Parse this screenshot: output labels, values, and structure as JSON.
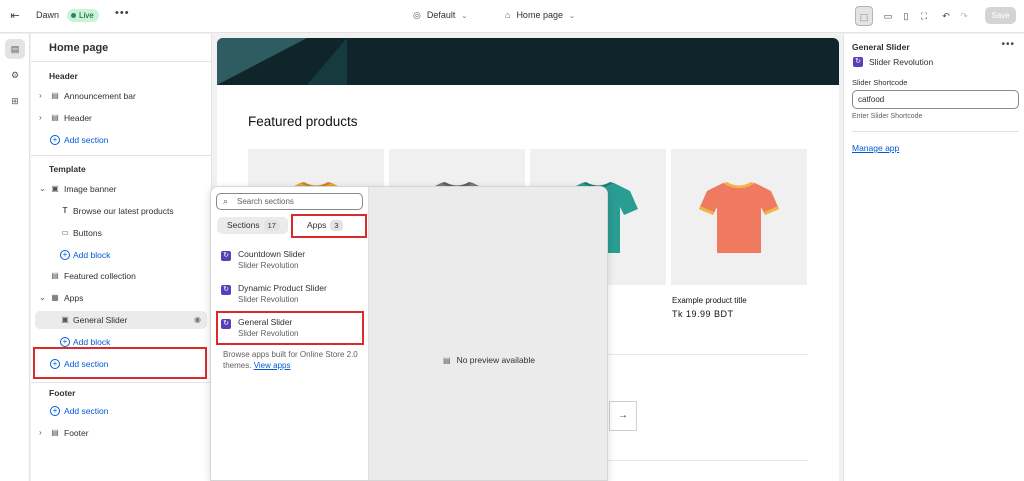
{
  "topbar": {
    "store_name": "Dawn",
    "live_badge": "Live",
    "theme_selector": "Default",
    "page_selector": "Home page",
    "save_label": "Save"
  },
  "left_panel": {
    "title": "Home page",
    "groups": {
      "header": "Header",
      "template": "Template",
      "footer": "Footer"
    },
    "items": {
      "announcement_bar": "Announcement bar",
      "header": "Header",
      "add_section": "Add section",
      "image_banner": "Image banner",
      "browse_text": "Browse our latest products",
      "buttons": "Buttons",
      "add_block": "Add block",
      "featured_collection": "Featured collection",
      "apps": "Apps",
      "general_slider": "General Slider",
      "footer": "Footer"
    }
  },
  "preview": {
    "section_title": "Featured products",
    "product_name": "Example product title",
    "product_price": "Tk 19.99 BDT",
    "products": [
      {
        "color": "#e8a43a",
        "collar": "#c9862a"
      },
      {
        "color": "#7a7a7a",
        "collar": "#5e5e5e"
      },
      {
        "color": "#2a9d93",
        "collar": "#1f7d75"
      },
      {
        "color": "#ef7a5f",
        "collar": "#f2b441"
      }
    ]
  },
  "picker": {
    "search_placeholder": "Search sections",
    "tabs": {
      "sections_label": "Sections",
      "sections_count": "17",
      "apps_label": "Apps",
      "apps_count": "3"
    },
    "apps": [
      {
        "name": "Countdown Slider",
        "vendor": "Slider Revolution"
      },
      {
        "name": "Dynamic Product Slider",
        "vendor": "Slider Revolution"
      },
      {
        "name": "General Slider",
        "vendor": "Slider Revolution"
      }
    ],
    "note_text": "Browse apps built for Online Store 2.0 themes.",
    "note_link": "View apps",
    "no_preview": "No preview available"
  },
  "right_panel": {
    "title": "General Slider",
    "app_name": "Slider Revolution",
    "field_label": "Slider Shortcode",
    "field_value": "catfood",
    "field_help": "Enter Slider Shortcode",
    "manage_link": "Manage app"
  },
  "colors": {
    "accent": "#005bd3",
    "highlight": "#d82c2c",
    "app_icon": "#5b3fb8",
    "live_badge_bg": "#c9f3d6"
  }
}
